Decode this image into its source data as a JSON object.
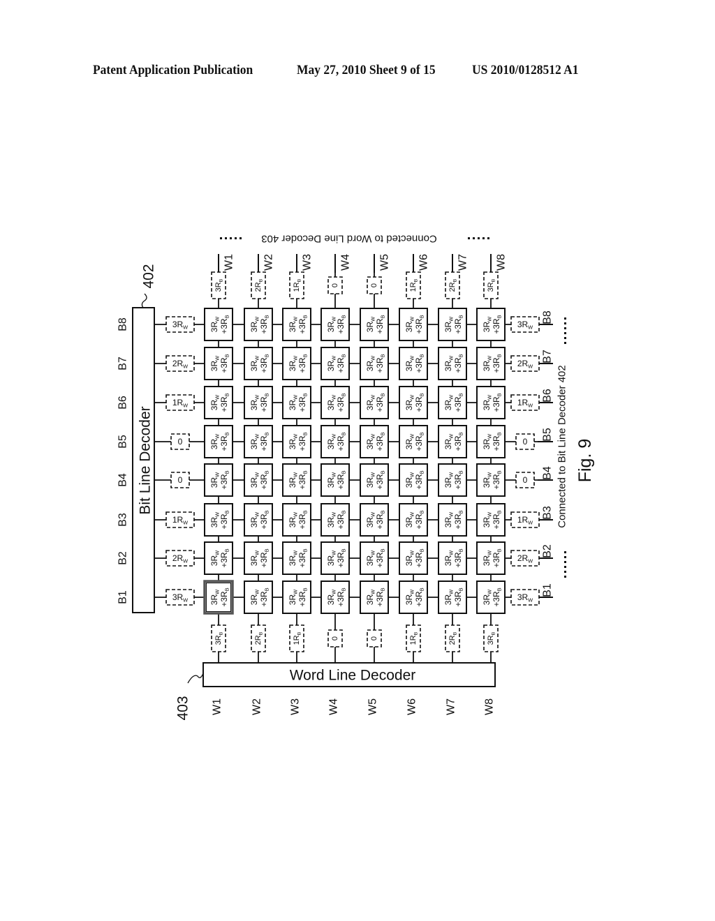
{
  "header": {
    "left": "Patent Application Publication",
    "middle": "May 27, 2010  Sheet 9 of 15",
    "right": "US 2010/0128512 A1"
  },
  "figure": {
    "caption": "Fig. 9",
    "bit_line_decoder": {
      "label": "Bit Line Decoder",
      "ref": "402"
    },
    "word_line_decoder": {
      "label": "Word Line Decoder",
      "ref": "403"
    },
    "top_note": "Connected to Word Line Decoder 403",
    "right_note": "Connected to Bit Line Decoder 402",
    "ellipsis": "......",
    "word_lines": [
      "W1",
      "W2",
      "W3",
      "W4",
      "W5",
      "W6",
      "W7",
      "W8"
    ],
    "bit_lines": [
      "B1",
      "B2",
      "B3",
      "B4",
      "B5",
      "B6",
      "B7",
      "B8"
    ],
    "word_line_resistors": [
      "3R_B",
      "2R_B",
      "1R_B",
      "0",
      "0",
      "1R_B",
      "2R_B",
      "3R_B"
    ],
    "bit_line_resistors": [
      "3R_W",
      "2R_W",
      "1R_W",
      "0",
      "0",
      "1R_W",
      "2R_W",
      "3R_W"
    ],
    "cell_label_line1": "3R_W",
    "cell_label_line2": "+3R_B",
    "highlighted_cell": {
      "word_line": "W1",
      "bit_line": "B1"
    }
  }
}
